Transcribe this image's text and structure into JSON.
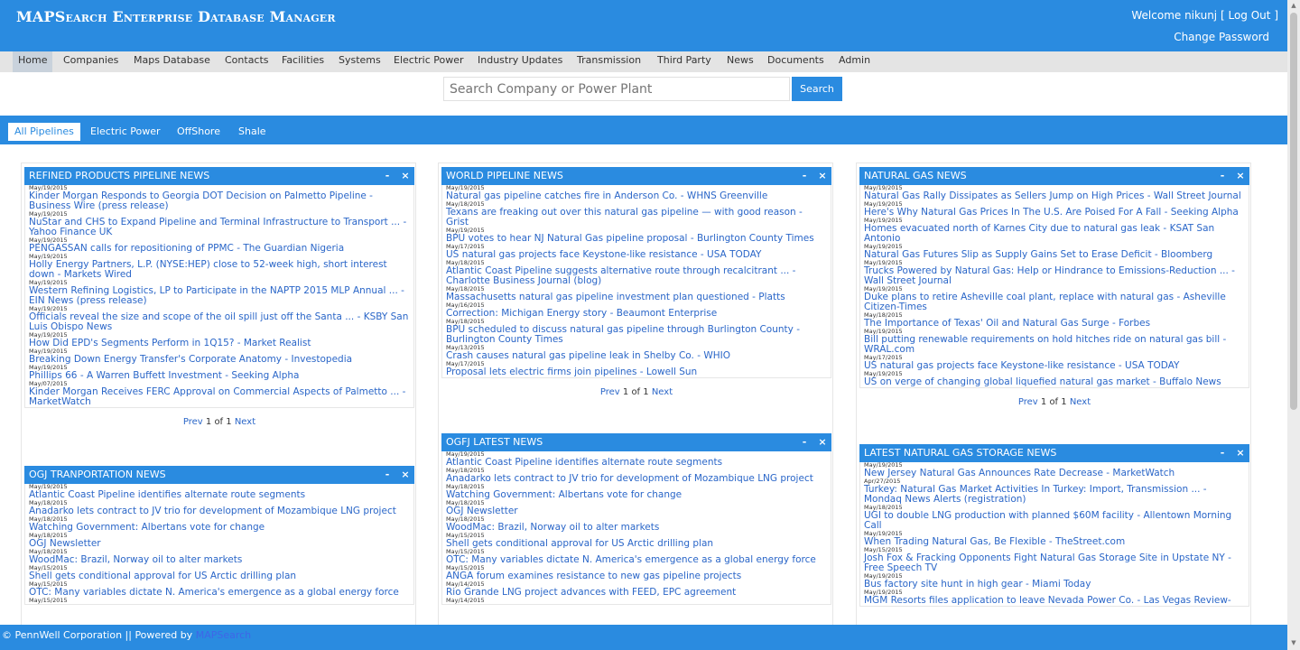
{
  "header": {
    "title": "MAPSearch Enterprise Database Manager",
    "welcome_prefix": "Welcome nikunj [",
    "logout": "Log Out",
    "welcome_suffix": "]",
    "change_password": "Change Password"
  },
  "nav": {
    "items": [
      {
        "label": "Home",
        "active": true
      },
      {
        "label": "Companies"
      },
      {
        "label": "Maps Database"
      },
      {
        "label": "Contacts"
      },
      {
        "label": "Facilities"
      },
      {
        "label": "Systems"
      },
      {
        "label": "Electric Power"
      },
      {
        "label": "Industry Updates"
      },
      {
        "label": "Transmission"
      },
      {
        "label": "Third Party"
      },
      {
        "label": "News"
      },
      {
        "label": "Documents"
      },
      {
        "label": "Admin"
      }
    ]
  },
  "search": {
    "placeholder": "Search Company or Power Plant",
    "button": "Search"
  },
  "subtabs": [
    {
      "label": "All Pipelines",
      "active": true
    },
    {
      "label": "Electric Power"
    },
    {
      "label": "OffShore"
    },
    {
      "label": "Shale"
    }
  ],
  "panels": {
    "refined": {
      "title": "REFINED PRODUCTS PIPELINE NEWS",
      "items": [
        {
          "date": "May/19/2015",
          "title": "Kinder Morgan Responds to Georgia DOT Decision on Palmetto Pipeline - Business Wire (press release)"
        },
        {
          "date": "May/19/2015",
          "title": "NuStar and CHS to Expand Pipeline and Terminal Infrastructure to Transport ... - Yahoo Finance UK"
        },
        {
          "date": "May/19/2015",
          "title": "PENGASSAN calls for repositioning of PPMC - The Guardian Nigeria"
        },
        {
          "date": "May/19/2015",
          "title": "Holly Energy Partners, L.P. (NYSE:HEP) close to 52-week high, short interest down - Markets Wired"
        },
        {
          "date": "May/19/2015",
          "title": "Western Refining Logistics, LP to Participate in the NAPTP 2015 MLP Annual ... - EIN News (press release)"
        },
        {
          "date": "May/19/2015",
          "title": "Officials reveal the size and scope of the oil spill just off the Santa ... - KSBY San Luis Obispo News"
        },
        {
          "date": "May/19/2015",
          "title": "How Did EPD's Segments Perform in 1Q15? - Market Realist"
        },
        {
          "date": "May/19/2015",
          "title": "Breaking Down Energy Transfer's Corporate Anatomy - Investopedia"
        },
        {
          "date": "May/19/2015",
          "title": "Phillips 66 - A Warren Buffett Investment - Seeking Alpha"
        },
        {
          "date": "May/07/2015",
          "title": "Kinder Morgan Receives FERC Approval on Commercial Aspects of Palmetto ... - MarketWatch"
        }
      ],
      "pager": {
        "prev": "Prev",
        "current": "1",
        "of": "of",
        "total": "1",
        "next": "Next"
      }
    },
    "ogj_transport": {
      "title": "OGJ TRANPORTATION NEWS",
      "items": [
        {
          "date": "May/19/2015",
          "title": "Atlantic Coast Pipeline identifies alternate route segments"
        },
        {
          "date": "May/18/2015",
          "title": "Anadarko lets contract to JV trio for development of Mozambique LNG project"
        },
        {
          "date": "May/18/2015",
          "title": "Watching Government: Albertans vote for change"
        },
        {
          "date": "May/18/2015",
          "title": "OGJ Newsletter"
        },
        {
          "date": "May/18/2015",
          "title": "WoodMac: Brazil, Norway oil to alter markets"
        },
        {
          "date": "May/15/2015",
          "title": "Shell gets conditional approval for US Arctic drilling plan"
        },
        {
          "date": "May/15/2015",
          "title": "OTC: Many variables dictate N. America's emergence as a global energy force"
        },
        {
          "date": "May/15/2015",
          "title": ""
        }
      ]
    },
    "world": {
      "title": "WORLD PIPELINE NEWS",
      "items": [
        {
          "date": "May/19/2015",
          "title": "Natural gas pipeline catches fire in Anderson Co. - WHNS Greenville"
        },
        {
          "date": "May/18/2015",
          "title": "Texans are freaking out over this natural gas pipeline — with good reason - Grist"
        },
        {
          "date": "May/19/2015",
          "title": "BPU votes to hear NJ Natural Gas pipeline proposal - Burlington County Times"
        },
        {
          "date": "May/17/2015",
          "title": "US natural gas projects face Keystone-like resistance - USA TODAY"
        },
        {
          "date": "May/18/2015",
          "title": "Atlantic Coast Pipeline suggests alternative route through recalcitrant ... - Charlotte Business Journal (blog)"
        },
        {
          "date": "May/18/2015",
          "title": "Massachusetts natural gas pipeline investment plan questioned - Platts"
        },
        {
          "date": "May/16/2015",
          "title": "Correction: Michigan Energy story - Beaumont Enterprise"
        },
        {
          "date": "May/18/2015",
          "title": "BPU scheduled to discuss natural gas pipeline through Burlington County - Burlington County Times"
        },
        {
          "date": "May/13/2015",
          "title": "Crash causes natural gas pipeline leak in Shelby Co. - WHIO"
        },
        {
          "date": "May/17/2015",
          "title": "Proposal lets electric firms join pipelines - Lowell Sun"
        }
      ],
      "pager": {
        "prev": "Prev",
        "current": "1",
        "of": "of",
        "total": "1",
        "next": "Next"
      }
    },
    "ogfj": {
      "title": "OGFJ LATEST NEWS",
      "items": [
        {
          "date": "May/19/2015",
          "title": "Atlantic Coast Pipeline identifies alternate route segments"
        },
        {
          "date": "May/18/2015",
          "title": "Anadarko lets contract to JV trio for development of Mozambique LNG project"
        },
        {
          "date": "May/18/2015",
          "title": "Watching Government: Albertans vote for change"
        },
        {
          "date": "May/18/2015",
          "title": "OGJ Newsletter"
        },
        {
          "date": "May/18/2015",
          "title": "WoodMac: Brazil, Norway oil to alter markets"
        },
        {
          "date": "May/15/2015",
          "title": "Shell gets conditional approval for US Arctic drilling plan"
        },
        {
          "date": "May/15/2015",
          "title": "OTC: Many variables dictate N. America's emergence as a global energy force"
        },
        {
          "date": "May/15/2015",
          "title": "ANGA forum examines resistance to new gas pipeline projects"
        },
        {
          "date": "May/14/2015",
          "title": "Rio Grande LNG project advances with FEED, EPC agreement"
        },
        {
          "date": "May/14/2015",
          "title": ""
        }
      ]
    },
    "natgas": {
      "title": "NATURAL GAS NEWS",
      "items": [
        {
          "date": "May/19/2015",
          "title": "Natural Gas Rally Dissipates as Sellers Jump on High Prices - Wall Street Journal"
        },
        {
          "date": "May/19/2015",
          "title": "Here's Why Natural Gas Prices In The U.S. Are Poised For A Fall - Seeking Alpha"
        },
        {
          "date": "May/19/2015",
          "title": "Homes evacuated north of Karnes City due to natural gas leak - KSAT San Antonio"
        },
        {
          "date": "May/19/2015",
          "title": "Natural Gas Futures Slip as Supply Gains Set to Erase Deficit - Bloomberg"
        },
        {
          "date": "May/19/2015",
          "title": "Trucks Powered by Natural Gas: Help or Hindrance to Emissions-Reduction ... - Wall Street Journal"
        },
        {
          "date": "May/19/2015",
          "title": "Duke plans to retire Asheville coal plant, replace with natural gas - Asheville Citizen-Times"
        },
        {
          "date": "May/18/2015",
          "title": "The Importance of Texas' Oil and Natural Gas Surge - Forbes"
        },
        {
          "date": "May/19/2015",
          "title": "Bill putting renewable requirements on hold hitches ride on natural gas bill - WRAL.com"
        },
        {
          "date": "May/17/2015",
          "title": "US natural gas projects face Keystone-like resistance - USA TODAY"
        },
        {
          "date": "May/19/2015",
          "title": "US on verge of changing global liquefied natural gas market - Buffalo News"
        }
      ],
      "pager": {
        "prev": "Prev",
        "current": "1",
        "of": "of",
        "total": "1",
        "next": "Next"
      }
    },
    "storage": {
      "title": "LATEST NATURAL GAS STORAGE NEWS",
      "items": [
        {
          "date": "May/19/2015",
          "title": "New Jersey Natural Gas Announces Rate Decrease - MarketWatch"
        },
        {
          "date": "Apr/27/2015",
          "title": "Turkey: Natural Gas Market Activities In Turkey: Import, Transmission ... - Mondaq News Alerts (registration)"
        },
        {
          "date": "May/18/2015",
          "title": "UGI to double LNG production with planned $60M facility - Allentown Morning Call"
        },
        {
          "date": "May/19/2015",
          "title": "When Trading Natural Gas, Be Flexible - TheStreet.com"
        },
        {
          "date": "May/15/2015",
          "title": "Josh Fox & Fracking Opponents Fight Natural Gas Storage Site in Upstate NY - Free Speech TV"
        },
        {
          "date": "May/19/2015",
          "title": "Bus factory site hunt in high gear - Miami Today"
        },
        {
          "date": "May/19/2015",
          "title": "MGM Resorts files application to leave Nevada Power Co. - Las Vegas Review-"
        }
      ]
    }
  },
  "panel_controls": {
    "minimize": "-",
    "close": "×"
  },
  "footer": {
    "text": "© PennWell Corporation || Powered by",
    "link": "MAPSearch"
  }
}
